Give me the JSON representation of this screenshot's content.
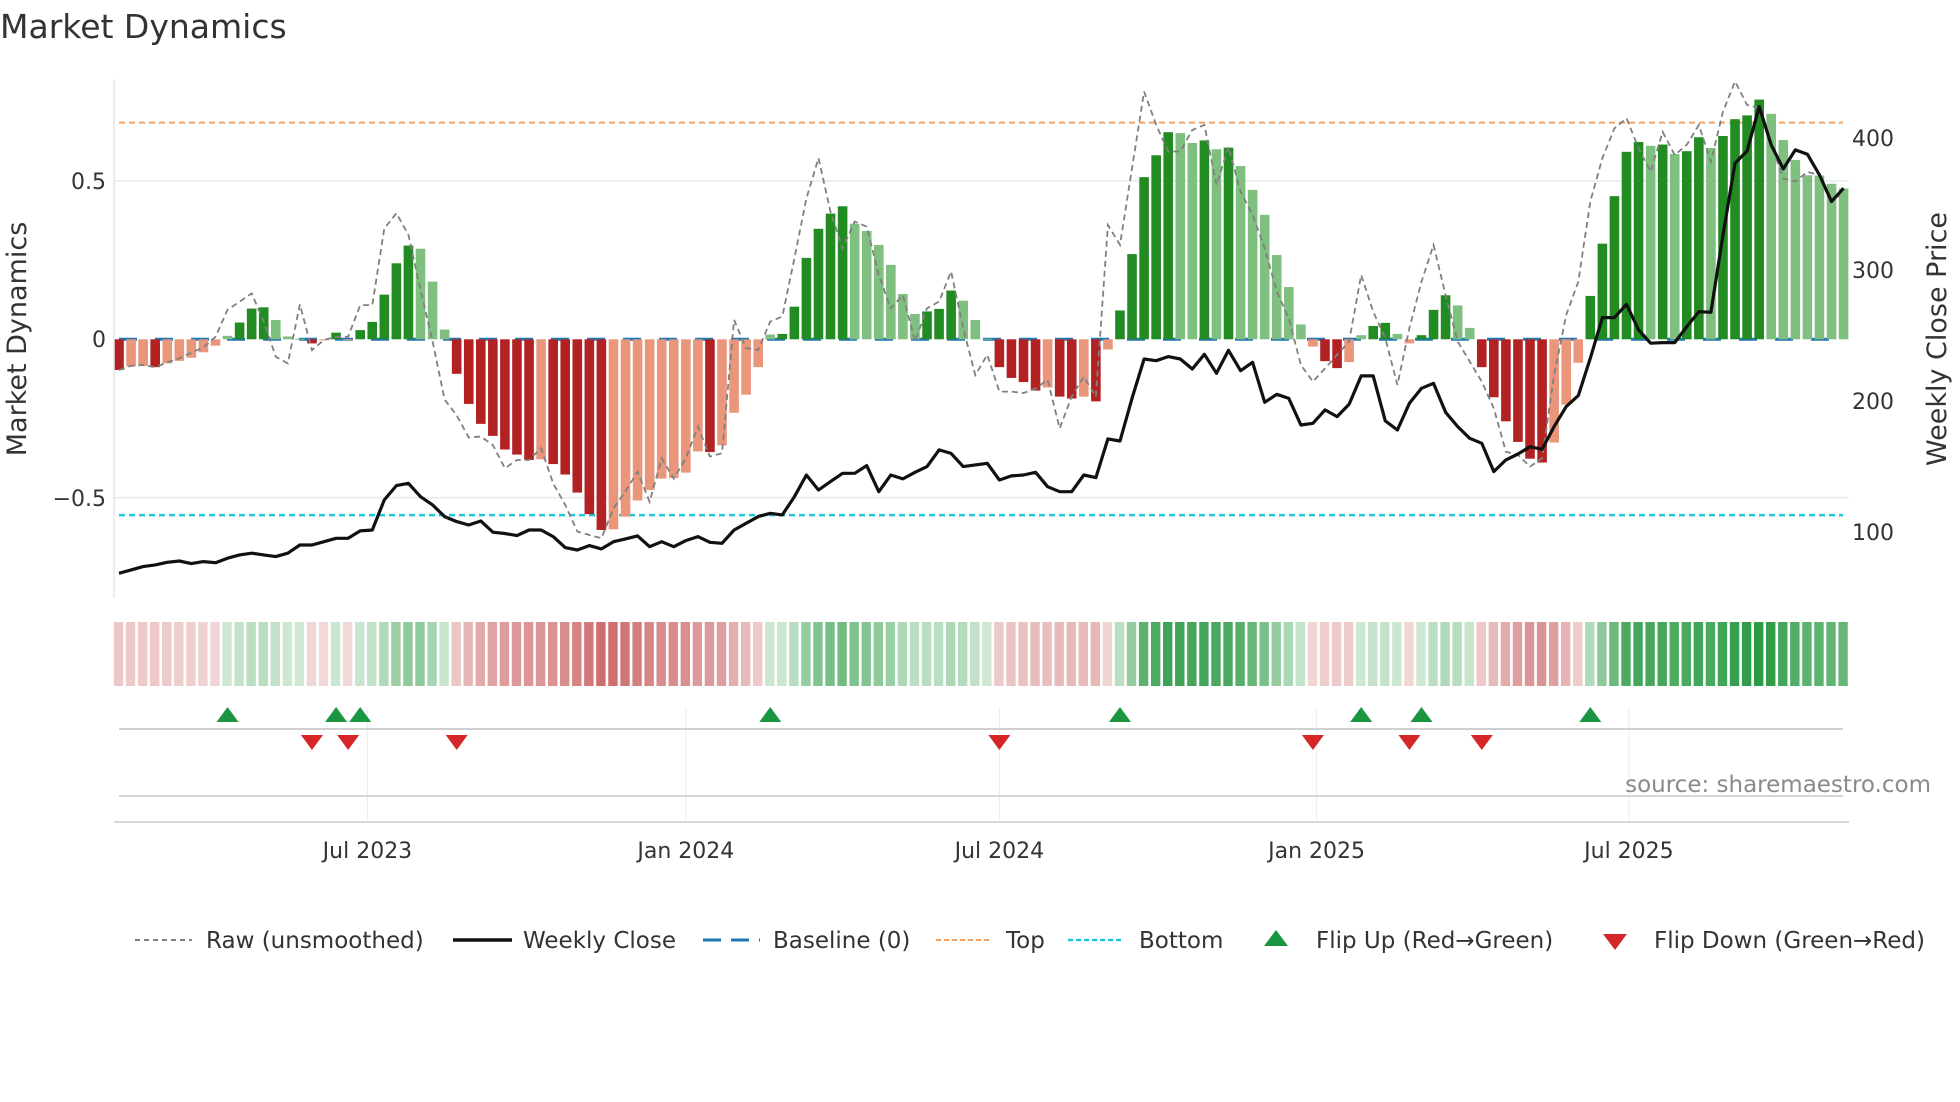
{
  "title": "Market Dynamics",
  "source": "source: sharemaestro.com",
  "colors": {
    "strong_green": "#228b22",
    "weak_green": "#7fbf7f",
    "strong_red": "#b22222",
    "weak_red": "#e9967a",
    "raw": "#808080",
    "close": "#111111",
    "baseline": "#1f77b4",
    "top": "#f4a460",
    "bottom": "#20c7d8",
    "flip_up": "#1a9641",
    "flip_down": "#d62728"
  },
  "chart_data": {
    "type": "bar",
    "title": "Market Dynamics",
    "xlabel": "",
    "ylabel": "Market Dynamics",
    "y2label": "Weekly Close Price",
    "ylim": [
      -0.82,
      0.825
    ],
    "y2lim": [
      52,
      453
    ],
    "yticks": [
      {
        "v": 0.5,
        "label": "0.5"
      },
      {
        "v": 0,
        "label": "0"
      },
      {
        "v": -0.5,
        "label": "−0.5"
      }
    ],
    "y2ticks": [
      {
        "v": 100,
        "label": "100"
      },
      {
        "v": 200,
        "label": "200"
      },
      {
        "v": 300,
        "label": "300"
      },
      {
        "v": 400,
        "label": "400"
      }
    ],
    "xticks": [
      {
        "week": 21.6,
        "label": "Jul 2023"
      },
      {
        "week": 48.0,
        "label": "Jan 2024"
      },
      {
        "week": 74.0,
        "label": "Jul 2024"
      },
      {
        "week": 100.3,
        "label": "Jan 2025"
      },
      {
        "week": 126.2,
        "label": "Jul 2025"
      }
    ],
    "top_level": 0.684,
    "bottom_level": -0.555,
    "baseline": 0,
    "grid": true,
    "legend_position": "bottom",
    "legend": [
      "Raw (unsmoothed)",
      "Weekly Close",
      "Baseline (0)",
      "Top",
      "Bottom",
      "Flip Up (Red→Green)",
      "Flip Down (Green→Red)"
    ],
    "momentum": [
      -0.097,
      -0.086,
      -0.084,
      -0.088,
      -0.076,
      -0.068,
      -0.058,
      -0.041,
      -0.02,
      0.011,
      0.053,
      0.097,
      0.101,
      0.061,
      0.009,
      0.002,
      -0.013,
      -0.003,
      0.021,
      -0.003,
      0.029,
      0.055,
      0.141,
      0.24,
      0.296,
      0.286,
      0.182,
      0.031,
      -0.109,
      -0.204,
      -0.267,
      -0.305,
      -0.348,
      -0.364,
      -0.381,
      -0.379,
      -0.394,
      -0.427,
      -0.484,
      -0.552,
      -0.602,
      -0.6,
      -0.56,
      -0.509,
      -0.476,
      -0.44,
      -0.438,
      -0.421,
      -0.354,
      -0.356,
      -0.335,
      -0.232,
      -0.175,
      -0.088,
      0.015,
      0.017,
      0.103,
      0.257,
      0.349,
      0.397,
      0.42,
      0.365,
      0.342,
      0.298,
      0.235,
      0.143,
      0.08,
      0.088,
      0.096,
      0.154,
      0.122,
      0.061,
      0.002,
      -0.088,
      -0.122,
      -0.135,
      -0.162,
      -0.152,
      -0.181,
      -0.187,
      -0.181,
      -0.196,
      -0.032,
      0.091,
      0.269,
      0.512,
      0.581,
      0.654,
      0.651,
      0.62,
      0.628,
      0.6,
      0.605,
      0.547,
      0.472,
      0.393,
      0.266,
      0.165,
      0.047,
      -0.023,
      -0.069,
      -0.091,
      -0.072,
      0.013,
      0.042,
      0.052,
      0.017,
      -0.013,
      0.013,
      0.093,
      0.139,
      0.107,
      0.036,
      -0.088,
      -0.183,
      -0.259,
      -0.324,
      -0.377,
      -0.389,
      -0.326,
      -0.206,
      -0.074,
      0.137,
      0.302,
      0.452,
      0.592,
      0.623,
      0.611,
      0.615,
      0.585,
      0.594,
      0.638,
      0.604,
      0.642,
      0.695,
      0.707,
      0.757,
      0.712,
      0.629,
      0.566,
      0.518,
      0.517,
      0.491,
      0.476
    ],
    "raw": [
      -0.097,
      -0.084,
      -0.081,
      -0.088,
      -0.073,
      -0.06,
      -0.042,
      -0.026,
      0.008,
      0.093,
      0.119,
      0.145,
      0.056,
      -0.055,
      -0.076,
      0.11,
      -0.034,
      -0.002,
      0.008,
      0.008,
      0.108,
      0.108,
      0.35,
      0.398,
      0.33,
      0.156,
      -0.007,
      -0.19,
      -0.24,
      -0.31,
      -0.307,
      -0.334,
      -0.407,
      -0.381,
      -0.381,
      -0.344,
      -0.455,
      -0.523,
      -0.607,
      -0.618,
      -0.628,
      -0.534,
      -0.48,
      -0.418,
      -0.513,
      -0.376,
      -0.44,
      -0.376,
      -0.276,
      -0.37,
      -0.36,
      0.061,
      -0.028,
      -0.034,
      0.056,
      0.072,
      0.256,
      0.445,
      0.572,
      0.403,
      0.287,
      0.372,
      0.356,
      0.203,
      0.098,
      0.14,
      -0.007,
      0.098,
      0.119,
      0.214,
      0.035,
      -0.113,
      -0.049,
      -0.165,
      -0.165,
      -0.17,
      -0.155,
      -0.128,
      -0.281,
      -0.181,
      -0.118,
      -0.181,
      0.361,
      0.298,
      0.54,
      0.782,
      0.677,
      0.593,
      0.593,
      0.661,
      0.677,
      0.487,
      0.608,
      0.466,
      0.393,
      0.287,
      0.151,
      0.066,
      -0.081,
      -0.134,
      -0.092,
      -0.049,
      -0.007,
      0.203,
      0.087,
      0.003,
      -0.144,
      0.035,
      0.182,
      0.298,
      0.14,
      -0.007,
      -0.07,
      -0.134,
      -0.218,
      -0.355,
      -0.365,
      -0.402,
      -0.376,
      -0.113,
      0.077,
      0.182,
      0.435,
      0.572,
      0.666,
      0.698,
      0.603,
      0.529,
      0.655,
      0.582,
      0.614,
      0.677,
      0.561,
      0.719,
      0.814,
      0.74,
      0.73,
      0.614,
      0.508,
      0.498,
      0.529,
      0.518,
      0.445,
      0.456
    ],
    "weekly_close": [
      68.9,
      71.5,
      74,
      75.3,
      77.3,
      78.3,
      76.3,
      77.8,
      77,
      80.4,
      82.9,
      84.2,
      82.9,
      81.6,
      84.2,
      90.5,
      90.5,
      93,
      95.6,
      95.6,
      101.2,
      101.9,
      124.8,
      135.7,
      137.5,
      127.3,
      121,
      112.1,
      108.3,
      105.7,
      108.8,
      100.2,
      99.2,
      97.6,
      101.9,
      101.9,
      96.9,
      88.5,
      86.7,
      90,
      87.5,
      93,
      95.1,
      97.4,
      89.2,
      93,
      89.2,
      93.8,
      96.9,
      92.5,
      91.8,
      101.9,
      107,
      112.1,
      114.6,
      113.4,
      127.3,
      143.8,
      132.4,
      138.8,
      145.1,
      145.1,
      151,
      131.1,
      143.8,
      140.8,
      145.9,
      150.2,
      162.9,
      160.3,
      150.2,
      151.5,
      152.7,
      140,
      143.1,
      143.8,
      145.9,
      134.9,
      131.1,
      131.1,
      143.8,
      141.8,
      171.3,
      169.7,
      202.2,
      232.2,
      230.9,
      234,
      232.2,
      224.6,
      235.8,
      221.3,
      238.8,
      223.3,
      229.7,
      199.2,
      205.3,
      202.2,
      181.9,
      183.2,
      193.4,
      188.3,
      197.7,
      219.3,
      219.3,
      185,
      178.1,
      198.4,
      209.9,
      213.7,
      191.6,
      180.7,
      171.8,
      168,
      146.4,
      155.3,
      159.8,
      165.4,
      163.4,
      180.7,
      195.9,
      204.3,
      232.7,
      263.7,
      263.7,
      273.9,
      254.3,
      244.2,
      244.7,
      244.7,
      256.9,
      268.3,
      267.8,
      326.7,
      381.3,
      390.7,
      424.5,
      395.3,
      377,
      391.5,
      388.2,
      372.4,
      352.1,
      362.3
    ],
    "flip_up_weeks": [
      10,
      19,
      21,
      55,
      84,
      104,
      109,
      123
    ],
    "flip_down_weeks": [
      17,
      20,
      29,
      74,
      100,
      108,
      114
    ]
  }
}
